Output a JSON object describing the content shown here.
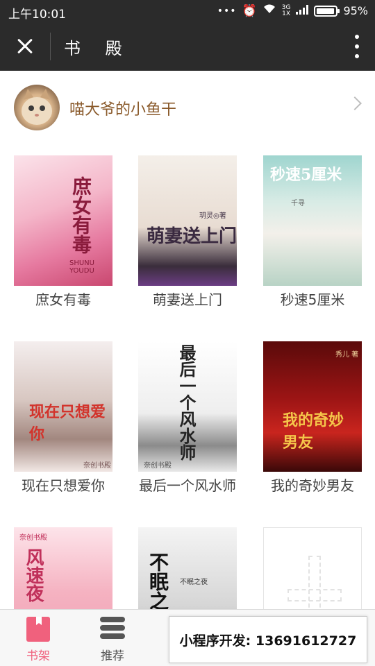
{
  "status_bar": {
    "time": "上午10:01",
    "dots": "•••",
    "network": [
      "3G",
      "1X"
    ],
    "battery_level": 0.95,
    "battery_text": "95%"
  },
  "header": {
    "title": "书 殿",
    "close_icon": "close-icon",
    "more_icon": "more-vertical-icon"
  },
  "user": {
    "name": "喵大爷的小鱼干",
    "avatar_icon": "cat-avatar"
  },
  "books": [
    {
      "title": "庶女有毒",
      "cover_text": "庶女有毒",
      "cover_sub": "SHUNU YOUDU"
    },
    {
      "title": "萌妻送上门",
      "cover_text": "萌妻送上门",
      "cover_sub": "玥灵◎著"
    },
    {
      "title": "秒速5厘米",
      "cover_text": "秒速5厘米",
      "cover_sub": "千寻"
    },
    {
      "title": "现在只想爱你",
      "cover_text": "现在只想爱你",
      "cover_sub": "奈创书殿"
    },
    {
      "title": "最后一个风水师",
      "cover_text": "最后一个风水师",
      "cover_sub": "奈创书殿"
    },
    {
      "title": "我的奇妙男友",
      "cover_text": "我的奇妙男友",
      "cover_sub": "秀儿 著"
    },
    {
      "title": "",
      "cover_text": "风速夜",
      "cover_sub": "奈创书殿"
    },
    {
      "title": "",
      "cover_text": "不眠之夜",
      "cover_sub": "不眠之夜"
    },
    {
      "title": "",
      "cover_text": "",
      "cover_sub": ""
    }
  ],
  "bottom_nav": {
    "tabs": [
      {
        "label": "书架",
        "icon": "bookshelf-icon",
        "active": true
      },
      {
        "label": "推荐",
        "icon": "recommend-stack-icon",
        "active": false
      }
    ]
  },
  "promo": {
    "text": "小程序开发: 13691612727"
  },
  "colors": {
    "header_bg": "#2b2b2b",
    "username": "#8a5a2b",
    "active_tab": "#f0617d"
  }
}
